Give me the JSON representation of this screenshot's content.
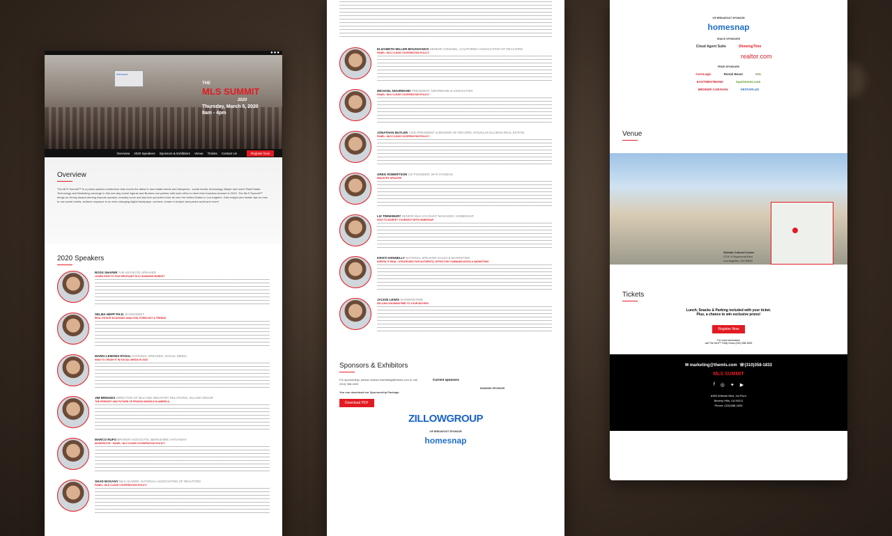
{
  "hero": {
    "logo_line1": "THE",
    "logo_main": "MLS SUMMIT",
    "logo_year": "2020",
    "date": "Thursday, March 5, 2020",
    "time": "8am - 4pm",
    "screen_text": "Welcome"
  },
  "nav": {
    "items": [
      "Overview",
      "2020 Speakers",
      "Sponsors & Exhibitors",
      "Venue",
      "Tickets",
      "Contact Us"
    ],
    "register": "Register Now"
  },
  "overview": {
    "title": "Overview",
    "text": "The MLS Summit™ is a power-packed conference that covers the latest in real estate trends and disruptors - social media, technology, Blayer and more! Real Estate Technology and Marketing converge in this one-day event! Agents and Brokers can partner with each other to drive their business forward in 2020. The MLS Summit™ brings an Emmy Award-winning keynote speaker, industry icons and key tech providers from all over the United States to Los Angeles. Gain insight and insider tips on how to use social media, achieve exposure in an ever-changing digital landscape, connect, create in today's fast-paced world and more!"
  },
  "speakers_title": "2020 Speakers",
  "speakers_col1": [
    {
      "name": "ROSS SHAFER",
      "tag": "THE KEYNOTE SPEAKER",
      "title": "LEARN HOW TO STAY RELEVANT IN A CHANGING MARKET"
    },
    {
      "name": "SELMA HEPP PH.D.",
      "tag": "ECONOMIST",
      "title": "REAL ESTATE ECONOMIC ANALYSIS, FORECAST & TRENDS"
    },
    {
      "name": "MARKI LEMONS-RYHAL",
      "tag": "NATIONAL SPEAKER, SOCIAL MEDIA",
      "title": "HOW TO CRUSH IT IN SOCIAL MEDIA IN 2020"
    },
    {
      "name": "JIM BRIDGES",
      "tag": "DIRECTOR OF MLS AND INDUSTRY RELATIONS, ZILLOW GROUP",
      "title": "THE PRESENT AND FUTURE OF PRICING MODELS IN AMERICA"
    },
    {
      "name": "MARCO RUFO",
      "tag": "BROKER ASSOCIATE, BERKSHIRE HATHAWAY",
      "title": "MODERATOR - PANEL: MLS CLEAR COOPERATION POLICY"
    },
    {
      "name": "SHAD BOGANY",
      "tag": "MLS LEADER, NATIONAL ASSOCIATION OF REALTORS",
      "title": "PANEL: MLS CLEAR COOPERATION POLICY"
    }
  ],
  "speakers_col2": [
    {
      "name": "ELIZABETH MILLER-BOUGHANOS",
      "tag": "SENIOR COUNSEL, CALIFORNIA ASSOCIATION OF REALTORS",
      "title": "PANEL: MLS CLEAR COOPERATION POLICY"
    },
    {
      "name": "MICHAEL NOURMAND",
      "tag": "PRESIDENT, NOURMAND & ASSOCIATES",
      "title": "PANEL: MLS CLEAR COOPERATION POLICY"
    },
    {
      "name": "JONATHAN BUTLER",
      "tag": "VICE PRESIDENT & BROKER OF RECORD, DOUGLAS ELLIMAN REAL ESTATE",
      "title": "PANEL: MLS CLEAR COOPERATION POLICY"
    },
    {
      "name": "GREG ROBERTSON",
      "tag": "CO-FOUNDER, W+R STUDIOS",
      "title": "INDUSTRY UPDATES"
    },
    {
      "name": "LIZ TRINKBURY",
      "tag": "SENIOR MLS ACCOUNT MANAGER, HOMESNAP",
      "title": "HOW TO MARKET YOURSELF WITH HOMESNAP"
    },
    {
      "name": "KRISTI KENNELLY",
      "tag": "NATIONAL SPEAKER SALES & MARKETING",
      "title": "KEEPIN' IT REAL: STRATEGIES FOR AUTHENTIC, EFFECTIVE COMMUNICATION & MARKETING"
    },
    {
      "name": "JACKIE LEWIS",
      "tag": "SHOWINGTIME",
      "title": "SELLING SHOWINGTIME TO YOUR BUYERS"
    }
  ],
  "sponsors": {
    "title": "Sponsors & Exhibitors",
    "contact": "For sponsorship, please contact marketing@themls.com or call (310) 358-1833",
    "download_note": "You can download our Sponsorship Package.",
    "download_btn": "Download PDF",
    "current": "Current sponsors",
    "diamond": "DIAMOND SPONSOR",
    "vip": "VIP BREAKFAST SPONSOR",
    "snack": "SNACK SPONSORS",
    "prize": "PRIZE SPONSORS",
    "zillow": "ZILLOWGROUP",
    "homesnap": "homesnap",
    "snack_list": [
      "Cloud Agent Suite",
      "ShowingTime"
    ],
    "realtor": "realtor.com",
    "prize_list": [
      "CoreLogic",
      "Rental Beast",
      "VAL",
      "EASTWESTBANK",
      "Apartments.com",
      "BROKER CARAVAN",
      "VESTAPLUS"
    ]
  },
  "venue": {
    "title": "Venue",
    "name": "Skirball Cultural Center",
    "addr1": "2701 N Sepulveda Blvd",
    "addr2": "Los Angeles, CA 90049"
  },
  "tickets": {
    "title": "Tickets",
    "line1": "Lunch, Snacks & Parking included with your ticket.",
    "line2": "Plus, a chance to win exclusive prizes!",
    "btn": "Register Now",
    "info": "For more information",
    "call": "call The MLS™ Kelly Gross (310) 358-1833"
  },
  "footer": {
    "email": "marketing@themls.com",
    "phone": "(310)358-1833",
    "address1": "8350 Wilshire Blvd, 1st Floor",
    "address2": "Beverly Hills, CA 90211",
    "address3": "Phone: (310)358-1833"
  }
}
